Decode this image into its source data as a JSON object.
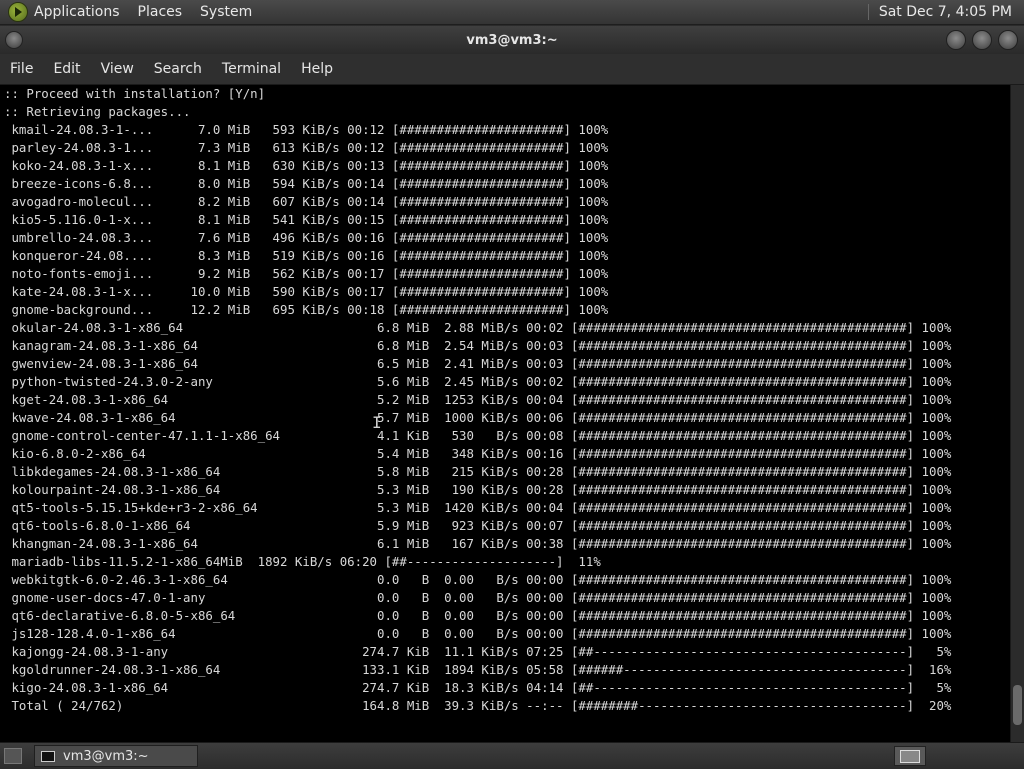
{
  "panel": {
    "menus": [
      "Applications",
      "Places",
      "System"
    ],
    "clock": "Sat Dec  7,  4:05 PM",
    "apps_icon": "distro-logo-icon"
  },
  "window": {
    "title": "vm3@vm3:~"
  },
  "menubar": [
    "File",
    "Edit",
    "View",
    "Search",
    "Terminal",
    "Help"
  ],
  "terminal": {
    "lines": [
      ":: Proceed with installation? [Y/n]",
      ":: Retrieving packages...",
      " kmail-24.08.3-1-...      7.0 MiB   593 KiB/s 00:12 [######################] 100%",
      " parley-24.08.3-1...      7.3 MiB   613 KiB/s 00:12 [######################] 100%",
      " koko-24.08.3-1-x...      8.1 MiB   630 KiB/s 00:13 [######################] 100%",
      " breeze-icons-6.8...      8.0 MiB   594 KiB/s 00:14 [######################] 100%",
      " avogadro-molecul...      8.2 MiB   607 KiB/s 00:14 [######################] 100%",
      " kio5-5.116.0-1-x...      8.1 MiB   541 KiB/s 00:15 [######################] 100%",
      " umbrello-24.08.3...      7.6 MiB   496 KiB/s 00:16 [######################] 100%",
      " konqueror-24.08....      8.3 MiB   519 KiB/s 00:16 [######################] 100%",
      " noto-fonts-emoji...      9.2 MiB   562 KiB/s 00:17 [######################] 100%",
      " kate-24.08.3-1-x...     10.0 MiB   590 KiB/s 00:17 [######################] 100%",
      " gnome-background...     12.2 MiB   695 KiB/s 00:18 [######################] 100%",
      " okular-24.08.3-1-x86_64                          6.8 MiB  2.88 MiB/s 00:02 [############################################] 100%",
      " kanagram-24.08.3-1-x86_64                        6.8 MiB  2.54 MiB/s 00:03 [############################################] 100%",
      " gwenview-24.08.3-1-x86_64                        6.5 MiB  2.41 MiB/s 00:03 [############################################] 100%",
      " python-twisted-24.3.0-2-any                      5.6 MiB  2.45 MiB/s 00:02 [############################################] 100%",
      " kget-24.08.3-1-x86_64                            5.2 MiB  1253 KiB/s 00:04 [############################################] 100%",
      " kwave-24.08.3-1-x86_64                           5.7 MiB  1000 KiB/s 00:06 [############################################] 100%",
      " gnome-control-center-47.1.1-1-x86_64             4.1 KiB   530   B/s 00:08 [############################################] 100%",
      " kio-6.8.0-2-x86_64                               5.4 MiB   348 KiB/s 00:16 [############################################] 100%",
      " libkdegames-24.08.3-1-x86_64                     5.8 MiB   215 KiB/s 00:28 [############################################] 100%",
      " kolourpaint-24.08.3-1-x86_64                     5.3 MiB   190 KiB/s 00:28 [############################################] 100%",
      " qt5-tools-5.15.15+kde+r3-2-x86_64                5.3 MiB  1420 KiB/s 00:04 [############################################] 100%",
      " qt6-tools-6.8.0-1-x86_64                         5.9 MiB   923 KiB/s 00:07 [############################################] 100%",
      " khangman-24.08.3-1-x86_64                        6.1 MiB   167 KiB/s 00:38 [############################################] 100%",
      " mariadb-libs-11.5.2-1-x86_64MiB  1892 KiB/s 06:20 [##--------------------]  11%",
      " webkitgtk-6.0-2.46.3-1-x86_64                    0.0   B  0.00   B/s 00:00 [############################################] 100%",
      " gnome-user-docs-47.0-1-any                       0.0   B  0.00   B/s 00:00 [############################################] 100%",
      " qt6-declarative-6.8.0-5-x86_64                   0.0   B  0.00   B/s 00:00 [############################################] 100%",
      " js128-128.4.0-1-x86_64                           0.0   B  0.00   B/s 00:00 [############################################] 100%",
      " kajongg-24.08.3-1-any                          274.7 KiB  11.1 KiB/s 07:25 [##------------------------------------------]   5%",
      " kgoldrunner-24.08.3-1-x86_64                   133.1 KiB  1894 KiB/s 05:58 [######--------------------------------------]  16%",
      " kigo-24.08.3-1-x86_64                          274.7 KiB  18.3 KiB/s 04:14 [##------------------------------------------]   5%",
      " Total ( 24/762)                                164.8 MiB  39.3 KiB/s --:-- [########------------------------------------]  20%"
    ]
  },
  "taskbar": {
    "window_label": "vm3@vm3:~"
  }
}
